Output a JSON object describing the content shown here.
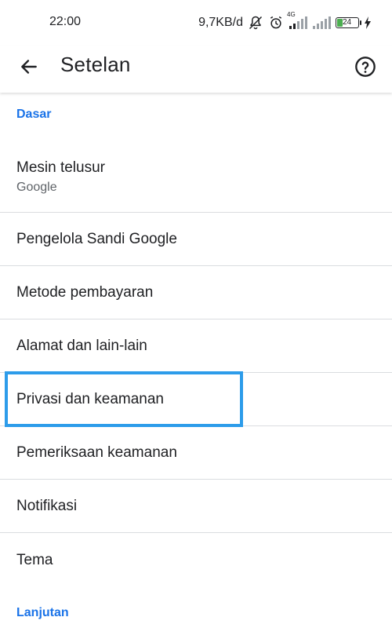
{
  "status_bar": {
    "time": "22:00",
    "network_speed": "9,7KB/d",
    "network_type": "4G",
    "battery_level": "24",
    "battery_percent": 24,
    "icons": [
      "notifications-off-icon",
      "alarm-icon",
      "signal-icon",
      "signal-icon",
      "battery-icon",
      "charging-icon"
    ]
  },
  "app_bar": {
    "title": "Setelan",
    "back_icon": "arrow-left-icon",
    "help_icon": "help-circle-icon"
  },
  "sections": {
    "basic_header": "Dasar",
    "advanced_header": "Lanjutan"
  },
  "items": [
    {
      "label": "Mesin telusur",
      "sublabel": "Google"
    },
    {
      "label": "Pengelola Sandi Google"
    },
    {
      "label": "Metode pembayaran"
    },
    {
      "label": "Alamat dan lain-lain"
    },
    {
      "label": "Privasi dan keamanan"
    },
    {
      "label": "Pemeriksaan keamanan"
    },
    {
      "label": "Notifikasi"
    },
    {
      "label": "Tema"
    }
  ],
  "colors": {
    "section_header": "#1a73e8",
    "highlight": "#2d9cea",
    "divider": "#dadce0",
    "battery_fill": "#4caf50"
  }
}
